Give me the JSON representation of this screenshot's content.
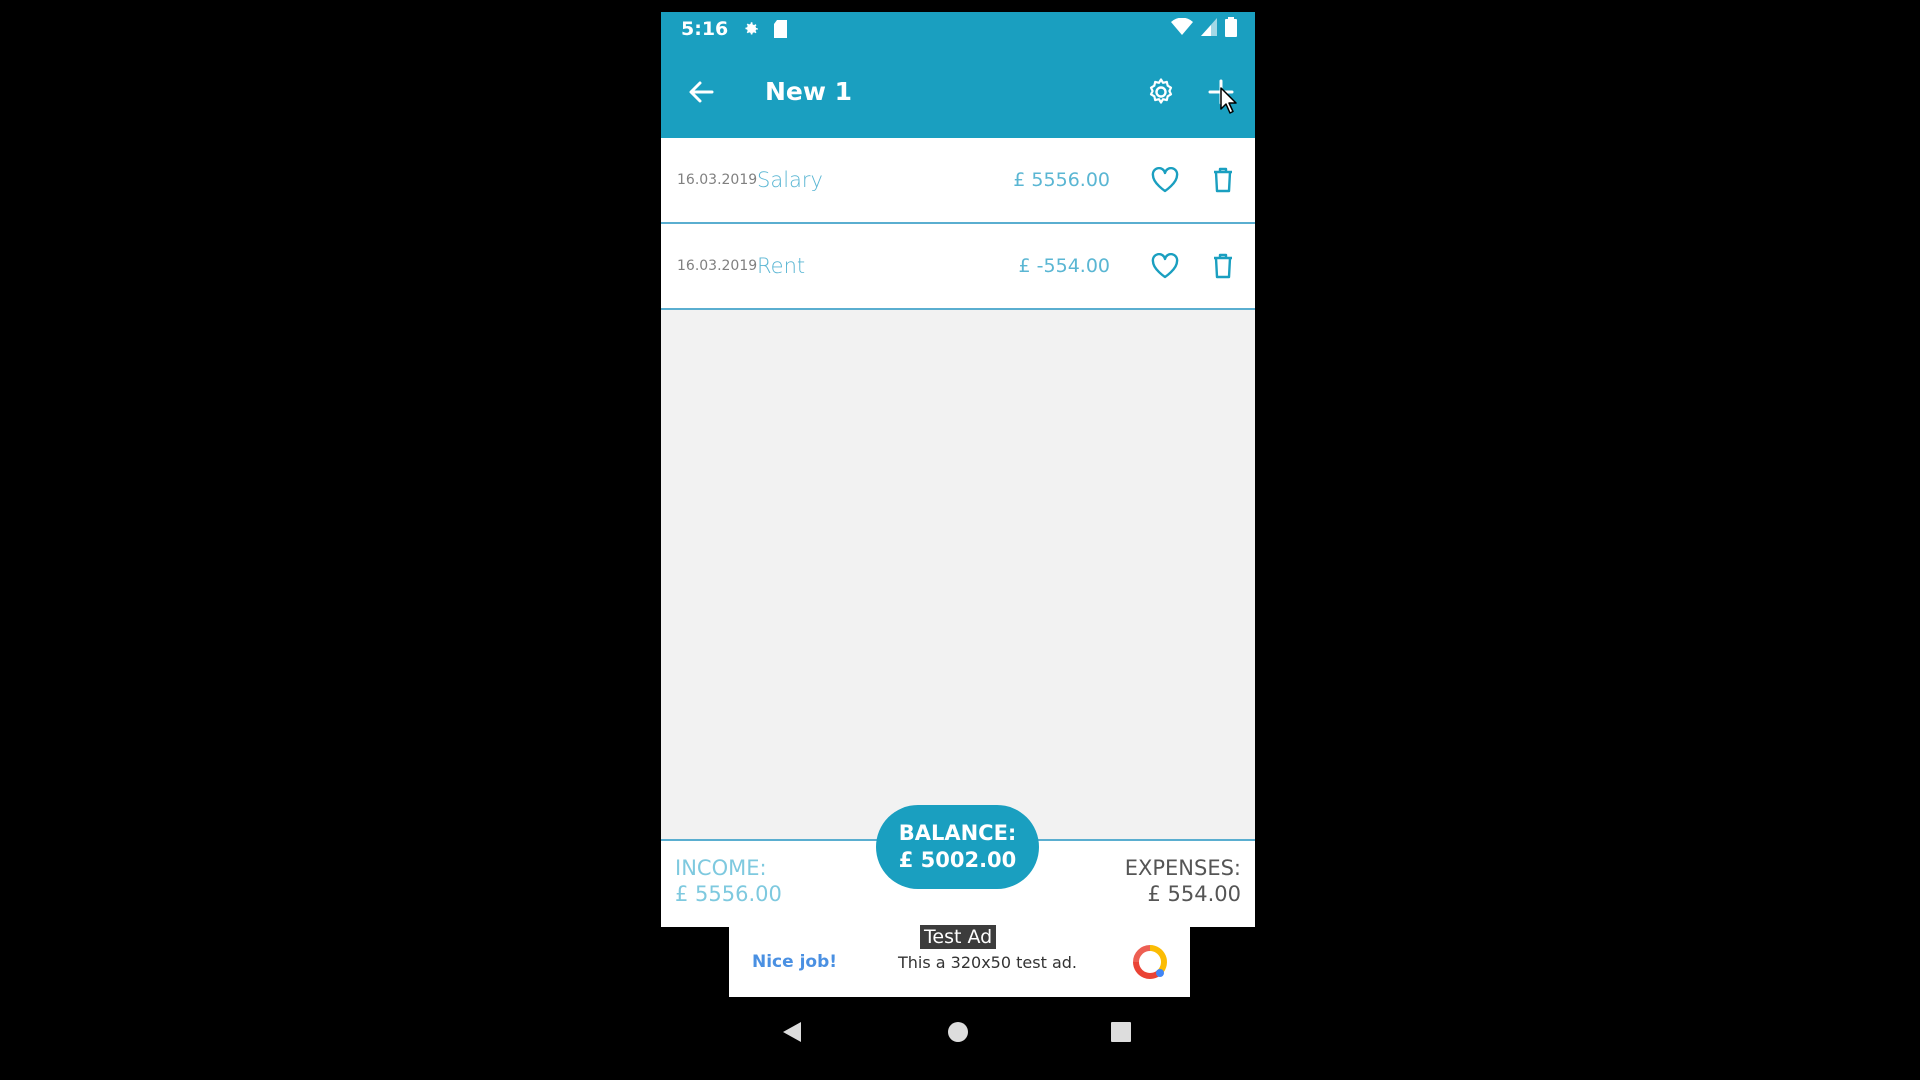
{
  "colors": {
    "accent": "#1a9fc0",
    "income": "#7ec9df",
    "label": "#5ab6d3",
    "divider": "#5aaed0"
  },
  "status_bar": {
    "time": "5:16",
    "icons": [
      "gear-icon",
      "sd-card-icon",
      "wifi-icon",
      "signal-icon",
      "battery-icon"
    ]
  },
  "app_bar": {
    "title": "New 1",
    "icons": [
      "back-arrow-icon",
      "settings-gear-icon",
      "add-plus-icon"
    ]
  },
  "transactions": [
    {
      "date": "16.03.2019",
      "label": "Salary",
      "amount": "£ 5556.00"
    },
    {
      "date": "16.03.2019",
      "label": "Rent",
      "amount": "£ -554.00"
    }
  ],
  "summary": {
    "balance_label": "BALANCE:",
    "balance_value": "£ 5002.00",
    "income_label": "INCOME:",
    "income_value": "£ 5556.00",
    "expenses_label": "EXPENSES:",
    "expenses_value": "£ 554.00"
  },
  "ad": {
    "tag": "Test Ad",
    "headline": "Nice job!",
    "text": "This a 320x50 test ad."
  },
  "nav_bar": {
    "icons": [
      "back-triangle-icon",
      "home-circle-icon",
      "recents-square-icon"
    ]
  }
}
